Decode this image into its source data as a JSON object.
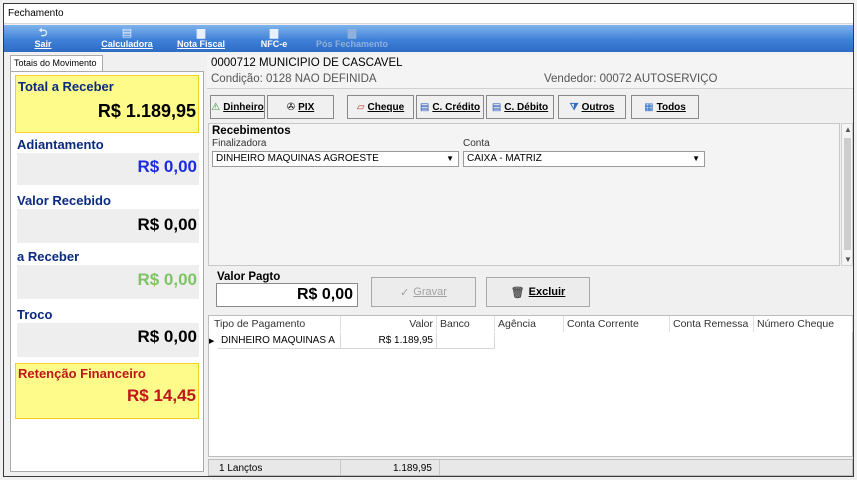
{
  "window": {
    "title": "Fechamento"
  },
  "toolbar": {
    "sair": "Sair",
    "calculadora": "Calculadora",
    "nota_fiscal": "Nota Fiscal",
    "nfce": "NFC-e",
    "pos_fechamento": "Pós Fechamento"
  },
  "left": {
    "tab": "Totais do Movimento",
    "total_receber": {
      "label": "Total a Receber",
      "value": "R$ 1.189,95",
      "color": "#000000"
    },
    "adiantamento": {
      "label": "Adiantamento",
      "value": "R$ 0,00",
      "color": "#1a2ee0"
    },
    "valor_recebido": {
      "label": "Valor Recebido",
      "value": "R$ 0,00",
      "color": "#000000"
    },
    "a_receber": {
      "label": "a Receber",
      "value": "R$ 0,00",
      "color": "#7ec466"
    },
    "troco": {
      "label": "Troco",
      "value": "R$ 0,00",
      "color": "#000000"
    },
    "retencao": {
      "label": "Retenção Financeiro",
      "value": "R$ 14,45",
      "color": "#c0151a"
    }
  },
  "header": {
    "cliente": "0000712 MUNICIPIO DE CASCAVEL",
    "condicao": "Condição: 0128 NAO DEFINIDA",
    "vendedor": "Vendedor: 00072 AUTOSERVIÇO"
  },
  "payments": {
    "dinheiro": "Dinheiro",
    "pix": "PIX",
    "cheque": "Cheque",
    "credito": "C. Crédito",
    "debito": "C. Débito",
    "outros": "Outros",
    "todos": "Todos"
  },
  "recebimentos": {
    "title": "Recebimentos",
    "finalizadora_label": "Finalizadora",
    "finalizadora_value": "DINHEIRO MAQUINAS AGROESTE",
    "conta_label": "Conta",
    "conta_value": "CAIXA - MATRIZ"
  },
  "valor_pago": {
    "label": "Valor Pagto",
    "value": "R$ 0,00"
  },
  "actions": {
    "gravar": "Gravar",
    "excluir": "Excluir"
  },
  "grid": {
    "headers": [
      "Tipo de Pagamento",
      "Valor",
      "Banco",
      "Agência",
      "Conta Corrente",
      "Conta Remessa",
      "Número Cheque"
    ],
    "rows": [
      {
        "tipo": "DINHEIRO MAQUINAS A",
        "valor": "R$ 1.189,95",
        "banco": "",
        "agencia": "",
        "conta_corrente": "",
        "conta_remessa": "",
        "numero_cheque": ""
      }
    ]
  },
  "footer": {
    "count": "1 Lançtos",
    "total": "1.189,95"
  }
}
